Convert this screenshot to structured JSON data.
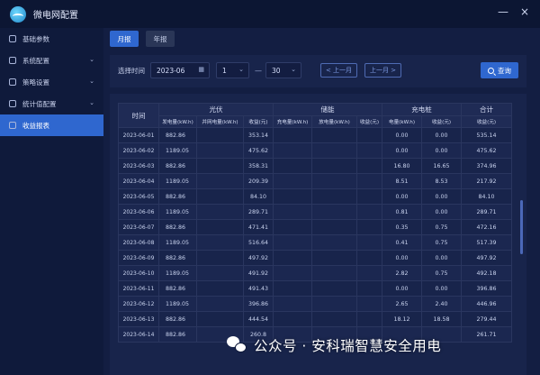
{
  "app": {
    "title": "微电网配置"
  },
  "window": {
    "minimize": "—",
    "close": "×"
  },
  "sidebar": {
    "items": [
      {
        "label": "基础参数"
      },
      {
        "label": "系统配置"
      },
      {
        "label": "策略设置"
      },
      {
        "label": "统计值配置"
      },
      {
        "label": "收益报表"
      }
    ]
  },
  "tabs": {
    "month": "月报",
    "year": "年报"
  },
  "filter": {
    "label": "选择时间",
    "date_value": "2023-06",
    "start_day": "1",
    "end_day": "30",
    "separator": "—",
    "prev": "< 上一月",
    "next": "上一月 >",
    "query": "查询"
  },
  "table": {
    "groups": {
      "time": "时间",
      "pv": "光伏",
      "storage": "储能",
      "charger": "充电桩",
      "total": "合计"
    },
    "columns": {
      "pv_gen": "发电量(kW.h)",
      "pv_grid": "并网电量(kW.h)",
      "pv_income": "收益(元)",
      "st_charge": "充电量(kW.h)",
      "st_discharge": "放电量(kW.h)",
      "st_income": "收益(元)",
      "ch_energy": "电量(kW.h)",
      "ch_income": "收益(元)",
      "total_income": "收益(元)"
    },
    "rows": [
      [
        "2023-06-01",
        "882.86",
        "",
        "353.14",
        "",
        "",
        "",
        "0.00",
        "0.00",
        "535.14"
      ],
      [
        "2023-06-02",
        "1189.05",
        "",
        "475.62",
        "",
        "",
        "",
        "0.00",
        "0.00",
        "475.62"
      ],
      [
        "2023-06-03",
        "882.86",
        "",
        "358.31",
        "",
        "",
        "",
        "16.80",
        "16.65",
        "374.96"
      ],
      [
        "2023-06-04",
        "1189.05",
        "",
        "209.39",
        "",
        "",
        "",
        "8.51",
        "8.53",
        "217.92"
      ],
      [
        "2023-06-05",
        "882.86",
        "",
        "84.10",
        "",
        "",
        "",
        "0.00",
        "0.00",
        "84.10"
      ],
      [
        "2023-06-06",
        "1189.05",
        "",
        "289.71",
        "",
        "",
        "",
        "0.81",
        "0.00",
        "289.71"
      ],
      [
        "2023-06-07",
        "882.86",
        "",
        "471.41",
        "",
        "",
        "",
        "0.35",
        "0.75",
        "472.16"
      ],
      [
        "2023-06-08",
        "1189.05",
        "",
        "516.64",
        "",
        "",
        "",
        "0.41",
        "0.75",
        "517.39"
      ],
      [
        "2023-06-09",
        "882.86",
        "",
        "497.92",
        "",
        "",
        "",
        "0.00",
        "0.00",
        "497.92"
      ],
      [
        "2023-06-10",
        "1189.05",
        "",
        "491.92",
        "",
        "",
        "",
        "2.82",
        "0.75",
        "492.18"
      ],
      [
        "2023-06-11",
        "882.86",
        "",
        "491.43",
        "",
        "",
        "",
        "0.00",
        "0.00",
        "396.86"
      ],
      [
        "2023-06-12",
        "1189.05",
        "",
        "396.86",
        "",
        "",
        "",
        "2.65",
        "2.40",
        "446.96"
      ],
      [
        "2023-06-13",
        "882.86",
        "",
        "444.54",
        "",
        "",
        "",
        "18.12",
        "18.58",
        "279.44"
      ],
      [
        "2023-06-14",
        "882.86",
        "",
        "260.8",
        "",
        "",
        "",
        "",
        "",
        "261.71"
      ]
    ]
  },
  "watermark": {
    "text": "公众号 · 安科瑞智慧安全用电"
  }
}
